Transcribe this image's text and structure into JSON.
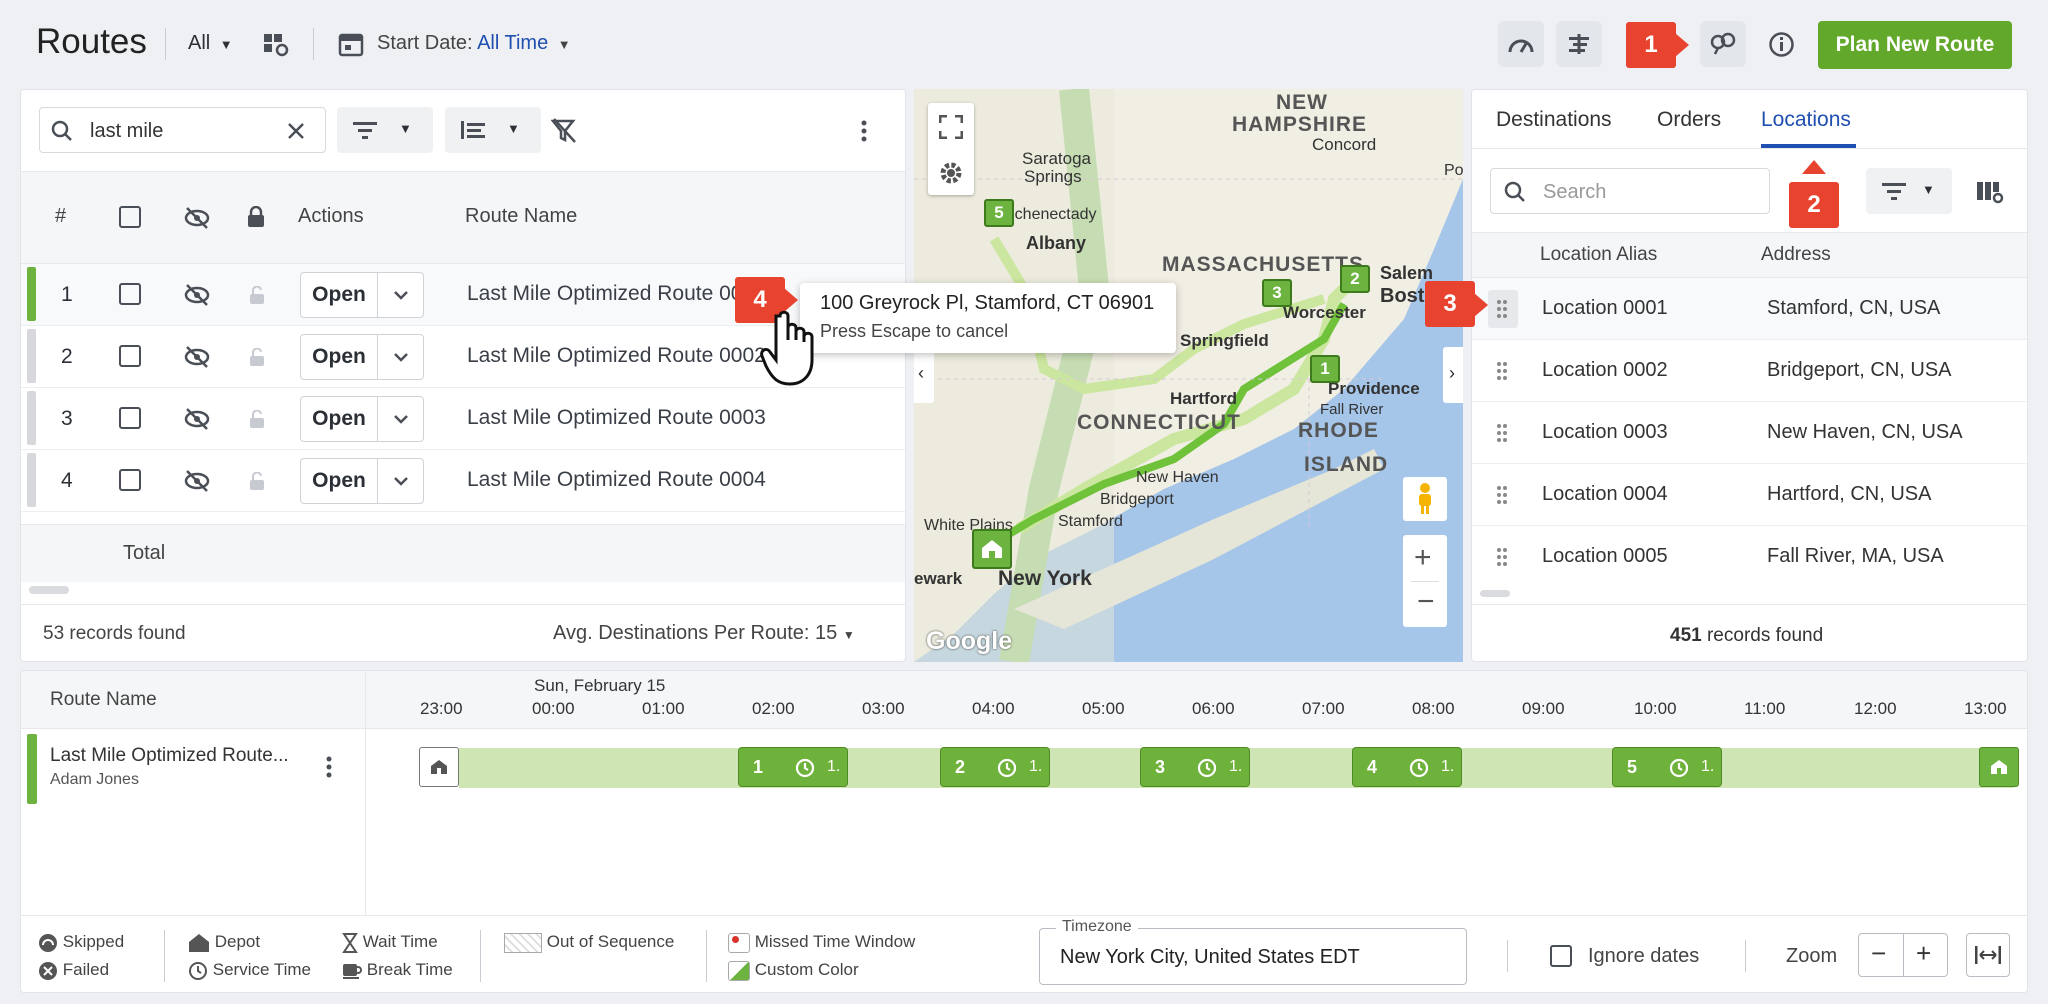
{
  "header": {
    "title": "Routes",
    "filter_all": "All",
    "start_date_label": "Start Date:",
    "start_date_value": "All Time",
    "plan_button": "Plan New Route"
  },
  "callouts": [
    "1",
    "2",
    "3",
    "4"
  ],
  "routes_panel": {
    "search_value": "last mile",
    "columns": [
      "#",
      "Actions",
      "Route Name"
    ],
    "rows": [
      {
        "num": "1",
        "action": "Open",
        "name": "Last Mile Optimized Route 00",
        "color": "#6cb33f"
      },
      {
        "num": "2",
        "action": "Open",
        "name": "Last Mile Optimized Route 0002",
        "color": "#d6d8db"
      },
      {
        "num": "3",
        "action": "Open",
        "name": "Last Mile Optimized Route 0003",
        "color": "#d6d8db"
      },
      {
        "num": "4",
        "action": "Open",
        "name": "Last Mile Optimized Route 0004",
        "color": "#d6d8db"
      }
    ],
    "total_label": "Total",
    "records_found": "53 records found",
    "avg_label": "Avg. Destinations Per Route: 15"
  },
  "tooltip": {
    "address": "100 Greyrock Pl, Stamford, CT 06901",
    "hint": "Press Escape to cancel"
  },
  "map": {
    "labels": {
      "new_hampshire_1": "NEW",
      "new_hampshire_2": "HAMPSHIRE",
      "massachusetts": "MASSACHUSETTS",
      "connecticut": "CONNECTICUT",
      "rhode_island_1": "RHODE",
      "rhode_island_2": "ISLAND",
      "saratoga_1": "Saratoga",
      "saratoga_2": "Springs",
      "schenectady": "Schenectady",
      "albany": "Albany",
      "concord": "Concord",
      "portsmouth": "Portsm",
      "worcester": "Worcester",
      "boston": "Bost",
      "salem": "Salem",
      "springfield": "Springfield",
      "hartford": "Hartford",
      "providence": "Providence",
      "fall_river": "Fall River",
      "new_haven": "New Haven",
      "bridgeport": "Bridgeport",
      "stamford": "Stamford",
      "white_plains": "White Plains",
      "newark": "ewark",
      "new_york": "New York",
      "google": "Google"
    },
    "markers": [
      "1",
      "2",
      "3",
      "5"
    ]
  },
  "locations_panel": {
    "tabs": [
      "Destinations",
      "Orders",
      "Locations"
    ],
    "active_tab": "Locations",
    "search_placeholder": "Search",
    "col_alias": "Location Alias",
    "col_address": "Address",
    "rows": [
      {
        "alias": "Location 0001",
        "address": "Stamford, CN, USA"
      },
      {
        "alias": "Location 0002",
        "address": "Bridgeport, CN, USA"
      },
      {
        "alias": "Location 0003",
        "address": "New Haven, CN, USA"
      },
      {
        "alias": "Location 0004",
        "address": "Hartford, CN, USA"
      },
      {
        "alias": "Location 0005",
        "address": "Fall River, MA, USA"
      }
    ],
    "records_count": "451",
    "records_label": "records found"
  },
  "timeline": {
    "col_header": "Route Name",
    "date_label": "Sun, February 15",
    "hours": [
      "23:00",
      "00:00",
      "01:00",
      "02:00",
      "03:00",
      "04:00",
      "05:00",
      "06:00",
      "07:00",
      "08:00",
      "09:00",
      "10:00",
      "11:00",
      "12:00",
      "13:00"
    ],
    "route_name": "Last Mile Optimized Route...",
    "driver": "Adam Jones",
    "stops": [
      {
        "num": "1",
        "dur": "1."
      },
      {
        "num": "2",
        "dur": "1."
      },
      {
        "num": "3",
        "dur": "1."
      },
      {
        "num": "4",
        "dur": "1."
      },
      {
        "num": "5",
        "dur": "1."
      }
    ]
  },
  "legend": {
    "skipped": "Skipped",
    "failed": "Failed",
    "depot": "Depot",
    "service_time": "Service Time",
    "wait_time": "Wait Time",
    "break_time": "Break Time",
    "out_of_sequence": "Out of Sequence",
    "missed_window": "Missed Time Window",
    "custom_color": "Custom Color",
    "timezone_label": "Timezone",
    "timezone_value": "New York City, United States EDT",
    "ignore_dates": "Ignore dates",
    "zoom": "Zoom"
  }
}
